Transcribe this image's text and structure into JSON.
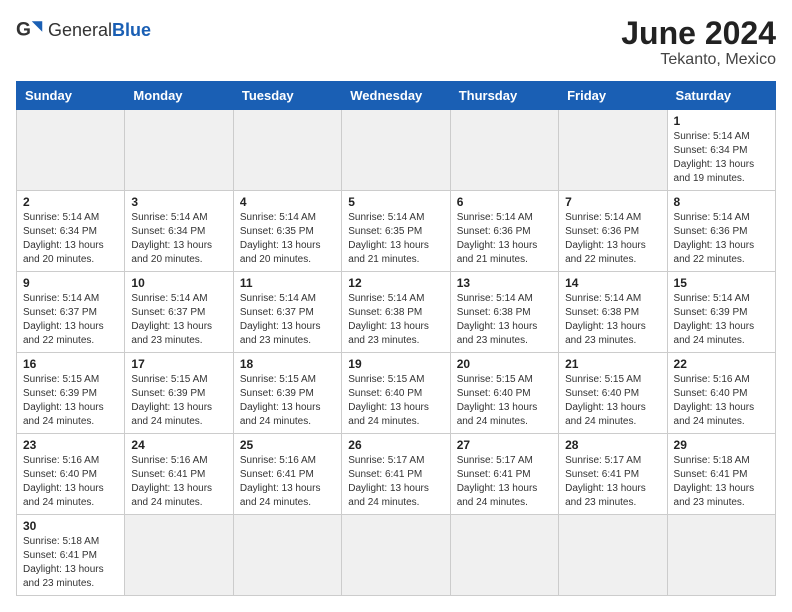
{
  "header": {
    "logo_general": "General",
    "logo_blue": "Blue",
    "month_title": "June 2024",
    "location": "Tekanto, Mexico"
  },
  "weekdays": [
    "Sunday",
    "Monday",
    "Tuesday",
    "Wednesday",
    "Thursday",
    "Friday",
    "Saturday"
  ],
  "weeks": [
    [
      {
        "day": null,
        "info": null
      },
      {
        "day": null,
        "info": null
      },
      {
        "day": null,
        "info": null
      },
      {
        "day": null,
        "info": null
      },
      {
        "day": null,
        "info": null
      },
      {
        "day": null,
        "info": null
      },
      {
        "day": "1",
        "info": "Sunrise: 5:14 AM\nSunset: 6:34 PM\nDaylight: 13 hours and 19 minutes."
      }
    ],
    [
      {
        "day": "2",
        "info": "Sunrise: 5:14 AM\nSunset: 6:34 PM\nDaylight: 13 hours and 20 minutes."
      },
      {
        "day": "3",
        "info": "Sunrise: 5:14 AM\nSunset: 6:34 PM\nDaylight: 13 hours and 20 minutes."
      },
      {
        "day": "4",
        "info": "Sunrise: 5:14 AM\nSunset: 6:35 PM\nDaylight: 13 hours and 20 minutes."
      },
      {
        "day": "5",
        "info": "Sunrise: 5:14 AM\nSunset: 6:35 PM\nDaylight: 13 hours and 21 minutes."
      },
      {
        "day": "6",
        "info": "Sunrise: 5:14 AM\nSunset: 6:36 PM\nDaylight: 13 hours and 21 minutes."
      },
      {
        "day": "7",
        "info": "Sunrise: 5:14 AM\nSunset: 6:36 PM\nDaylight: 13 hours and 22 minutes."
      },
      {
        "day": "8",
        "info": "Sunrise: 5:14 AM\nSunset: 6:36 PM\nDaylight: 13 hours and 22 minutes."
      }
    ],
    [
      {
        "day": "9",
        "info": "Sunrise: 5:14 AM\nSunset: 6:37 PM\nDaylight: 13 hours and 22 minutes."
      },
      {
        "day": "10",
        "info": "Sunrise: 5:14 AM\nSunset: 6:37 PM\nDaylight: 13 hours and 23 minutes."
      },
      {
        "day": "11",
        "info": "Sunrise: 5:14 AM\nSunset: 6:37 PM\nDaylight: 13 hours and 23 minutes."
      },
      {
        "day": "12",
        "info": "Sunrise: 5:14 AM\nSunset: 6:38 PM\nDaylight: 13 hours and 23 minutes."
      },
      {
        "day": "13",
        "info": "Sunrise: 5:14 AM\nSunset: 6:38 PM\nDaylight: 13 hours and 23 minutes."
      },
      {
        "day": "14",
        "info": "Sunrise: 5:14 AM\nSunset: 6:38 PM\nDaylight: 13 hours and 23 minutes."
      },
      {
        "day": "15",
        "info": "Sunrise: 5:14 AM\nSunset: 6:39 PM\nDaylight: 13 hours and 24 minutes."
      }
    ],
    [
      {
        "day": "16",
        "info": "Sunrise: 5:15 AM\nSunset: 6:39 PM\nDaylight: 13 hours and 24 minutes."
      },
      {
        "day": "17",
        "info": "Sunrise: 5:15 AM\nSunset: 6:39 PM\nDaylight: 13 hours and 24 minutes."
      },
      {
        "day": "18",
        "info": "Sunrise: 5:15 AM\nSunset: 6:39 PM\nDaylight: 13 hours and 24 minutes."
      },
      {
        "day": "19",
        "info": "Sunrise: 5:15 AM\nSunset: 6:40 PM\nDaylight: 13 hours and 24 minutes."
      },
      {
        "day": "20",
        "info": "Sunrise: 5:15 AM\nSunset: 6:40 PM\nDaylight: 13 hours and 24 minutes."
      },
      {
        "day": "21",
        "info": "Sunrise: 5:15 AM\nSunset: 6:40 PM\nDaylight: 13 hours and 24 minutes."
      },
      {
        "day": "22",
        "info": "Sunrise: 5:16 AM\nSunset: 6:40 PM\nDaylight: 13 hours and 24 minutes."
      }
    ],
    [
      {
        "day": "23",
        "info": "Sunrise: 5:16 AM\nSunset: 6:40 PM\nDaylight: 13 hours and 24 minutes."
      },
      {
        "day": "24",
        "info": "Sunrise: 5:16 AM\nSunset: 6:41 PM\nDaylight: 13 hours and 24 minutes."
      },
      {
        "day": "25",
        "info": "Sunrise: 5:16 AM\nSunset: 6:41 PM\nDaylight: 13 hours and 24 minutes."
      },
      {
        "day": "26",
        "info": "Sunrise: 5:17 AM\nSunset: 6:41 PM\nDaylight: 13 hours and 24 minutes."
      },
      {
        "day": "27",
        "info": "Sunrise: 5:17 AM\nSunset: 6:41 PM\nDaylight: 13 hours and 24 minutes."
      },
      {
        "day": "28",
        "info": "Sunrise: 5:17 AM\nSunset: 6:41 PM\nDaylight: 13 hours and 23 minutes."
      },
      {
        "day": "29",
        "info": "Sunrise: 5:18 AM\nSunset: 6:41 PM\nDaylight: 13 hours and 23 minutes."
      }
    ],
    [
      {
        "day": "30",
        "info": "Sunrise: 5:18 AM\nSunset: 6:41 PM\nDaylight: 13 hours and 23 minutes."
      },
      {
        "day": null,
        "info": null
      },
      {
        "day": null,
        "info": null
      },
      {
        "day": null,
        "info": null
      },
      {
        "day": null,
        "info": null
      },
      {
        "day": null,
        "info": null
      },
      {
        "day": null,
        "info": null
      }
    ]
  ]
}
